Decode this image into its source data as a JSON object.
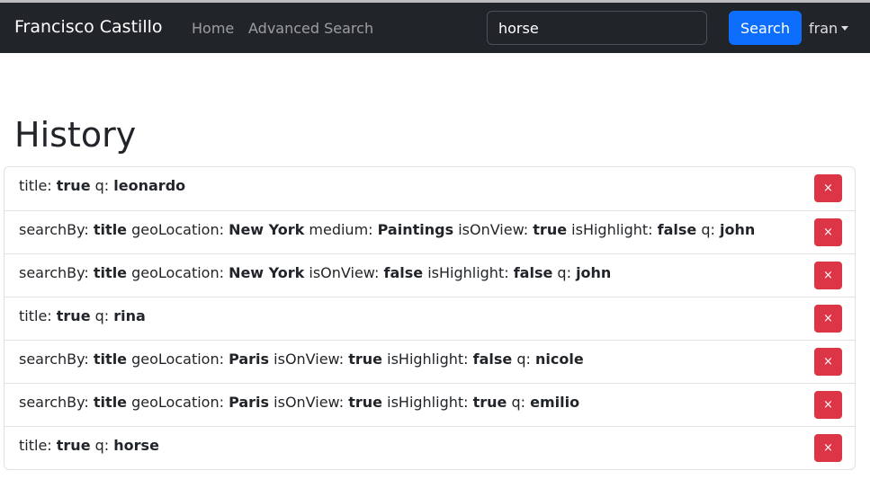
{
  "navbar": {
    "brand": "Francisco Castillo",
    "links": [
      "Home",
      "Advanced Search"
    ],
    "search_value": "horse",
    "search_button": "Search",
    "user": "fran"
  },
  "page": {
    "title": "History"
  },
  "history": [
    {
      "parts": [
        {
          "k": "title: ",
          "v": "true"
        },
        {
          "k": "q: ",
          "v": "leonardo"
        }
      ]
    },
    {
      "parts": [
        {
          "k": "searchBy: ",
          "v": "title"
        },
        {
          "k": "geoLocation: ",
          "v": "New York"
        },
        {
          "k": "medium: ",
          "v": "Paintings"
        },
        {
          "k": "isOnView: ",
          "v": "true"
        },
        {
          "k": "isHighlight: ",
          "v": "false"
        },
        {
          "k": "q: ",
          "v": "john"
        }
      ]
    },
    {
      "parts": [
        {
          "k": "searchBy: ",
          "v": "title"
        },
        {
          "k": "geoLocation: ",
          "v": "New York"
        },
        {
          "k": "isOnView: ",
          "v": "false"
        },
        {
          "k": "isHighlight: ",
          "v": "false"
        },
        {
          "k": "q: ",
          "v": "john"
        }
      ]
    },
    {
      "parts": [
        {
          "k": "title: ",
          "v": "true"
        },
        {
          "k": "q: ",
          "v": "rina"
        }
      ]
    },
    {
      "parts": [
        {
          "k": "searchBy: ",
          "v": "title"
        },
        {
          "k": "geoLocation: ",
          "v": "Paris"
        },
        {
          "k": "isOnView: ",
          "v": "true"
        },
        {
          "k": "isHighlight: ",
          "v": "false"
        },
        {
          "k": "q: ",
          "v": "nicole"
        }
      ]
    },
    {
      "parts": [
        {
          "k": "searchBy: ",
          "v": "title"
        },
        {
          "k": "geoLocation: ",
          "v": "Paris"
        },
        {
          "k": "isOnView: ",
          "v": "true"
        },
        {
          "k": "isHighlight: ",
          "v": "true"
        },
        {
          "k": "q: ",
          "v": "emilio"
        }
      ]
    },
    {
      "parts": [
        {
          "k": "title: ",
          "v": "true"
        },
        {
          "k": "q: ",
          "v": "horse"
        }
      ]
    }
  ],
  "delete_icon": "close-icon",
  "delete_glyph": "×",
  "colors": {
    "navbar": "#212529",
    "primary": "#0d6efd",
    "danger": "#dc3545"
  }
}
